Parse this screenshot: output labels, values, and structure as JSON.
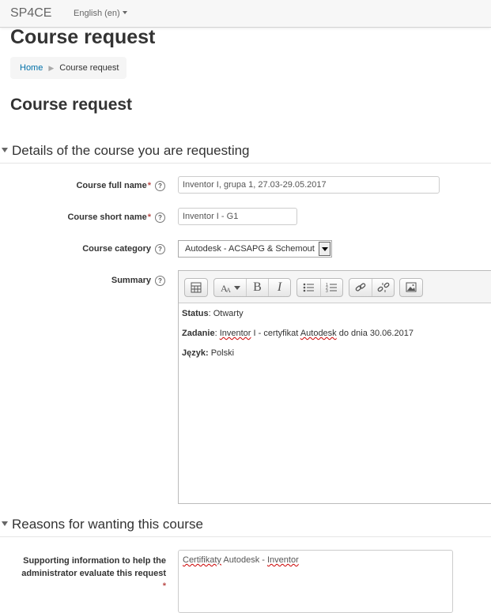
{
  "navbar": {
    "brand": "SP4CE",
    "language": "English (en)"
  },
  "page": {
    "header": "Course request",
    "title": "Course request"
  },
  "breadcrumb": {
    "home": "Home",
    "current": "Course request"
  },
  "sections": {
    "details": "Details of the course you are requesting",
    "reasons": "Reasons for wanting this course"
  },
  "form": {
    "fullname_label": "Course full name",
    "fullname_value": "Inventor I, grupa 1, 27.03-29.05.2017",
    "shortname_label": "Course short name",
    "shortname_value": "Inventor I - G1",
    "category_label": "Course category",
    "category_value": "Autodesk - ACSAPG & Schemout",
    "summary_label": "Summary",
    "required_mark": "*",
    "help_glyph": "?"
  },
  "summary": {
    "status_key": "Status",
    "status_value": ": Otwarty",
    "task_key": "Zadanie",
    "task_value_1": ": ",
    "task_value_inventor": "Inventor",
    "task_value_2": " I - certyfikat ",
    "task_value_autodesk": "Autodesk",
    "task_value_3": " do dnia 30.06.2017",
    "lang_key": "Język:",
    "lang_value": " Polski"
  },
  "toolbar": {
    "bold": "B",
    "italic": "I",
    "icons": [
      "toolbar-toggle-icon",
      "font-style-icon",
      "bold-icon",
      "italic-icon",
      "unordered-list-icon",
      "ordered-list-icon",
      "link-icon",
      "unlink-icon",
      "image-icon"
    ]
  },
  "reason": {
    "label_line1": "Supporting information to help the",
    "label_line2": "administrator evaluate this request",
    "value_a": "Certifikaty",
    "value_b": " Autodesk - ",
    "value_c": "Inventor"
  }
}
